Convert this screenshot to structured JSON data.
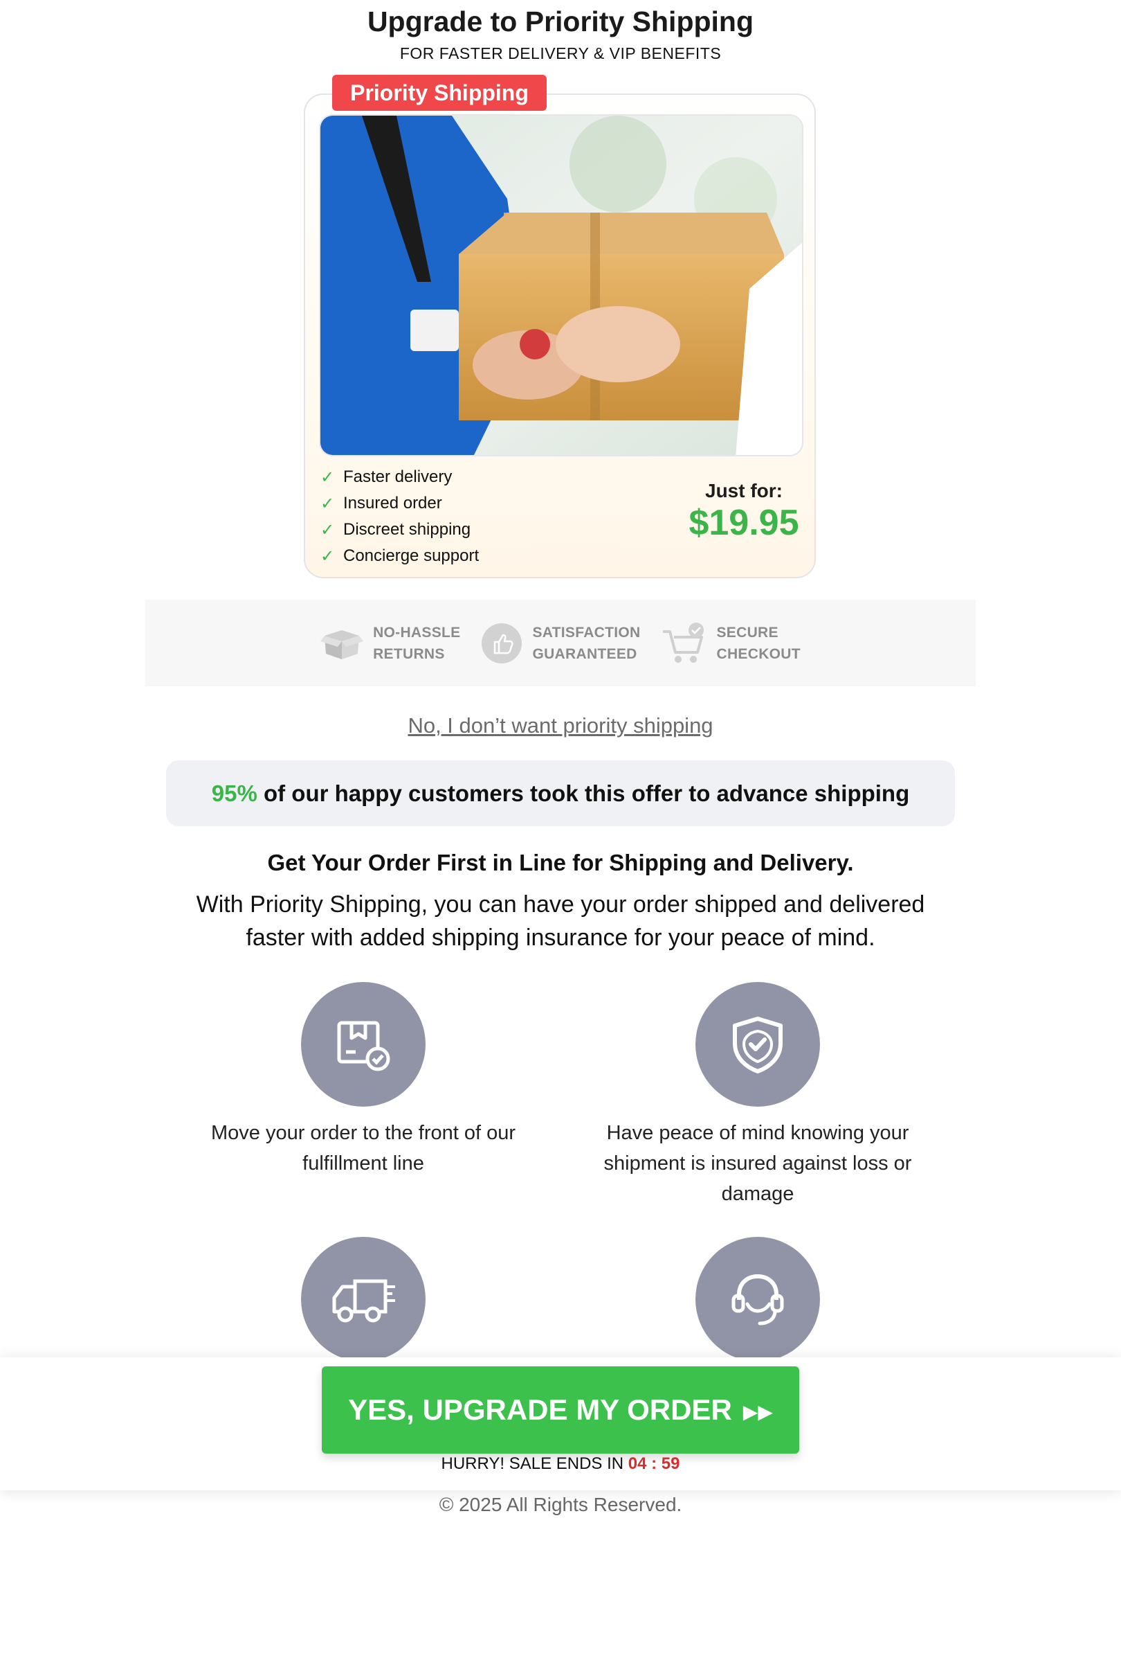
{
  "header": {
    "title": "Upgrade to Priority Shipping",
    "subtitle": "FOR FASTER DELIVERY & VIP BENEFITS"
  },
  "offer": {
    "badge": "Priority Shipping",
    "features": [
      "Faster delivery",
      "Insured order",
      "Discreet shipping",
      "Concierge support"
    ],
    "price_label": "Just for:",
    "price": "$19.95"
  },
  "trust": [
    {
      "icon": "open-box-icon",
      "line1": "NO-HASSLE",
      "line2": "RETURNS"
    },
    {
      "icon": "thumbs-up-icon",
      "line1": "SATISFACTION",
      "line2": "GUARANTEED"
    },
    {
      "icon": "cart-check-icon",
      "line1": "SECURE",
      "line2": "CHECKOUT"
    }
  ],
  "decline_link": "No, I don’t want priority shipping",
  "stat": {
    "percent": "95%",
    "text": " of our happy customers took this offer to advance shipping"
  },
  "headline": "Get Your Order First in Line for Shipping and Delivery.",
  "description": "With Priority Shipping, you can have your order shipped and delivered faster with added shipping insurance for your peace of mind.",
  "benefits": [
    {
      "icon": "package-check-icon",
      "text": "Move your order to the front of our fulfillment line"
    },
    {
      "icon": "shield-check-icon",
      "text": "Have peace of mind knowing your shipment is insured against loss or damage"
    },
    {
      "icon": "delivery-truck-icon",
      "text": ""
    },
    {
      "icon": "headset-icon",
      "text": ""
    }
  ],
  "cta": {
    "label": "YES, UPGRADE MY ORDER",
    "arrows": "▶▶",
    "hurry_text": "HURRY! SALE ENDS IN ",
    "timer": "04 : 59"
  },
  "footer": "© 2025 All Rights Reserved.",
  "colors": {
    "accent_green": "#3bb54a",
    "badge_red": "#f0474a",
    "icon_circle": "#9094a6",
    "timer_red": "#d32f2f"
  }
}
